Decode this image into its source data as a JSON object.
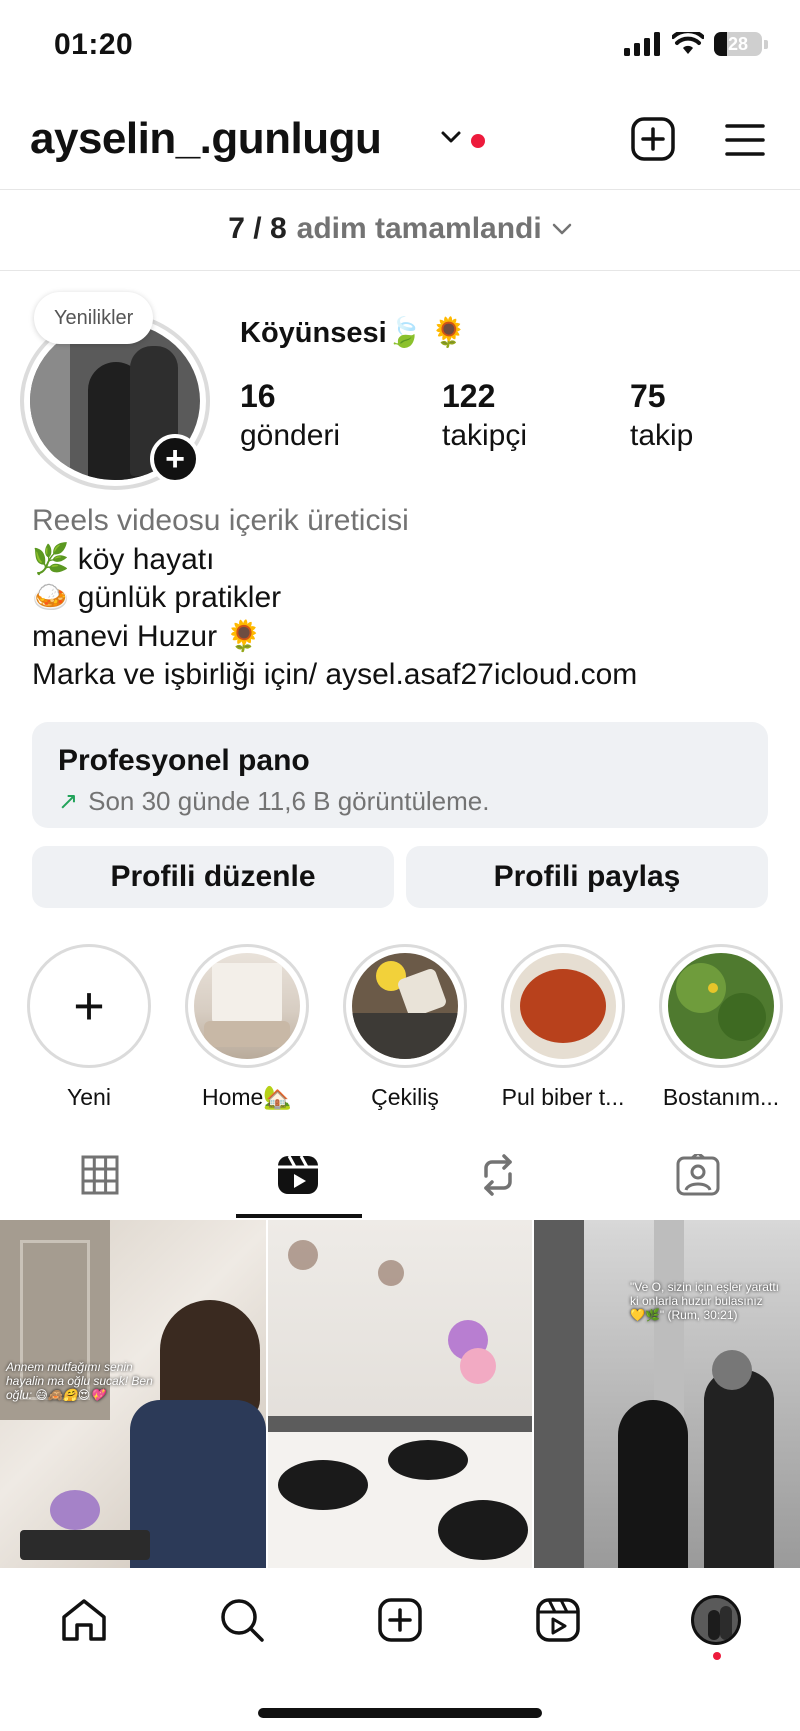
{
  "status_bar": {
    "time": "01:20",
    "battery_level": "28"
  },
  "header": {
    "username": "ayselin_.gunlugu"
  },
  "steps": {
    "count": "7 / 8",
    "label": "adim tamamlandi"
  },
  "profile": {
    "note": "Yenilikler",
    "display_name": "Köyünsesi🍃 🌻",
    "stats": [
      {
        "value": "16",
        "label": "gönderi"
      },
      {
        "value": "122",
        "label": "takipçi"
      },
      {
        "value": "75",
        "label": "takip"
      }
    ],
    "bio": {
      "category": "Reels videosu içerik üreticisi",
      "lines": [
        "🌿 köy hayatı",
        "🍛 günlük pratikler",
        "manevi Huzur 🌻",
        "Marka ve işbirliği için/ aysel.asaf27icloud.com"
      ]
    }
  },
  "dashboard": {
    "title": "Profesyonel pano",
    "subtitle": "Son 30 günde 11,6 B görüntüleme."
  },
  "buttons": {
    "edit_profile": "Profili düzenle",
    "share_profile": "Profili paylaş"
  },
  "highlights": [
    {
      "label": "Yeni"
    },
    {
      "label": "Home🏡"
    },
    {
      "label": "Çekiliş"
    },
    {
      "label": "Pul biber t..."
    },
    {
      "label": "Bostanım..."
    }
  ],
  "tabs": [
    "grid",
    "reels",
    "reposts",
    "tagged"
  ],
  "active_tab": "reels",
  "grid_posts": [
    {
      "overlay_text": "Annem mutfağımı senin hayalin ma oğlu sucak! Ben oğlu: 😅🙈🤗😍💖"
    },
    {
      "overlay_text": ""
    },
    {
      "overlay_text": "\"Ve O, sizin için eşler yarattı ki onlarla huzur bulasınız 💛🌿\" (Rum, 30:21)"
    }
  ],
  "bottom_nav": [
    "home",
    "search",
    "create",
    "reels",
    "profile"
  ],
  "colors": {
    "accent_red": "#ed1b3c",
    "muted_text": "#737373",
    "button_bg": "#eff1f4",
    "trend_green": "#22a35a"
  }
}
